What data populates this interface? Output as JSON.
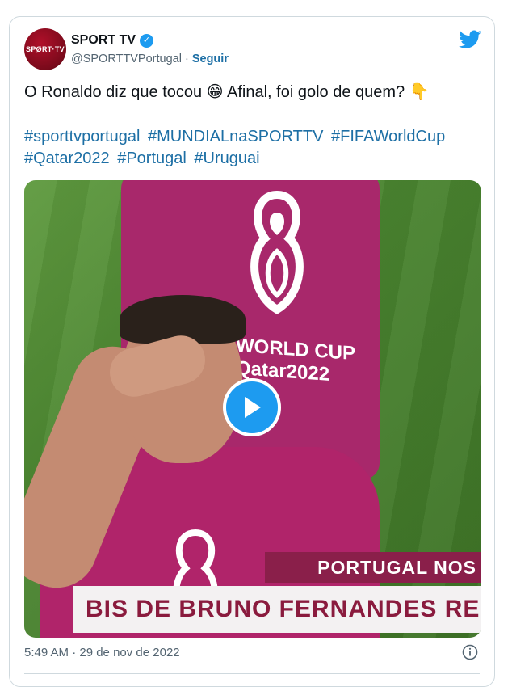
{
  "account": {
    "avatar_text": "SPØRT·TV",
    "name": "SPORT TV",
    "verified_symbol": "✓",
    "handle": "@SPORTTVPortugal",
    "separator": " · ",
    "follow_label": "Seguir"
  },
  "tweet": {
    "text_part1": "O Ronaldo diz que tocou ",
    "emoji1": "😁",
    "text_part2": " Afinal, foi golo de quem? ",
    "emoji2": "👇",
    "hashtags": [
      "#sporttvportugal",
      "#MUNDIALnaSPORTTV",
      "#FIFAWorldCup",
      "#Qatar2022",
      "#Portugal",
      "#Uruguai"
    ]
  },
  "media": {
    "overlay_wc_line1": "WORLD CUP",
    "overlay_wc_line2": "Qatar2022",
    "ticker_top": "PORTUGAL NOS",
    "ticker_bottom": "BIS DE BRUNO FERNANDES RES"
  },
  "footer": {
    "timestamp": "5:49 AM · 29 de nov de 2022"
  },
  "icons": {
    "brand": "twitter-bird-icon",
    "info": "info-icon",
    "play": "play-icon",
    "verified": "verified-badge-icon"
  },
  "colors": {
    "link": "#1d6fa5",
    "brand_blue": "#1d9bf0",
    "secondary_text": "#536471",
    "ticker_maroon": "#8a1f4a"
  }
}
